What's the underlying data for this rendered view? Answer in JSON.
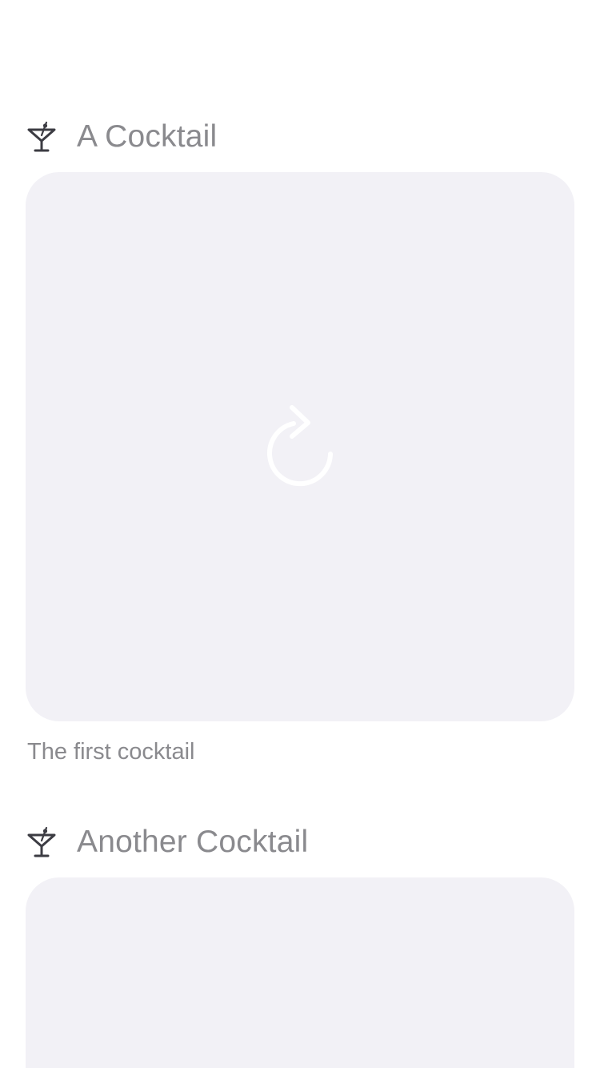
{
  "cards": [
    {
      "title": "A Cocktail",
      "caption": "The first cocktail",
      "icon": "cocktail-glass-icon",
      "image_state": "loading",
      "image_icon": "reload-icon"
    },
    {
      "title": "Another Cocktail",
      "caption": "",
      "icon": "cocktail-glass-icon",
      "image_state": "loading",
      "image_icon": ""
    }
  ],
  "colors": {
    "background": "#ffffff",
    "text_secondary": "#8a8a8e",
    "placeholder": "#f2f1f6",
    "icon": "#3c3c43"
  }
}
